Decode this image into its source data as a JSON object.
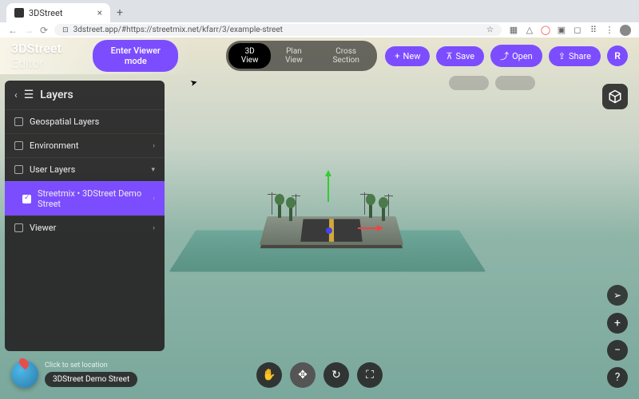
{
  "browser": {
    "tab_title": "3DStreet",
    "url": "3dstreet.app/#https://streetmix.net/kfarr/3/example-street"
  },
  "header": {
    "logo_main": "3DStreet",
    "logo_sub": "Editor",
    "viewer_mode_btn": "Enter Viewer mode",
    "views": {
      "view3d": "3D View",
      "plan": "Plan View",
      "cross": "Cross Section"
    },
    "actions": {
      "new": "New",
      "save": "Save",
      "open": "Open",
      "share": "Share"
    },
    "avatar_letter": "R"
  },
  "sidebar": {
    "title": "Layers",
    "items": [
      {
        "label": "Geospatial Layers",
        "selected": false,
        "indent": false,
        "chevron": ""
      },
      {
        "label": "Environment",
        "selected": false,
        "indent": false,
        "chevron": "›"
      },
      {
        "label": "User Layers",
        "selected": false,
        "indent": false,
        "chevron": "▾"
      },
      {
        "label": "Streetmix • 3DStreet Demo Street",
        "selected": true,
        "indent": true,
        "chevron": "›"
      },
      {
        "label": "Viewer",
        "selected": false,
        "indent": false,
        "chevron": "›"
      }
    ]
  },
  "location": {
    "hint": "Click to set location",
    "name": "3DStreet Demo Street"
  },
  "right_tools": {
    "zoom_in": "+",
    "zoom_out": "−",
    "help": "?"
  }
}
